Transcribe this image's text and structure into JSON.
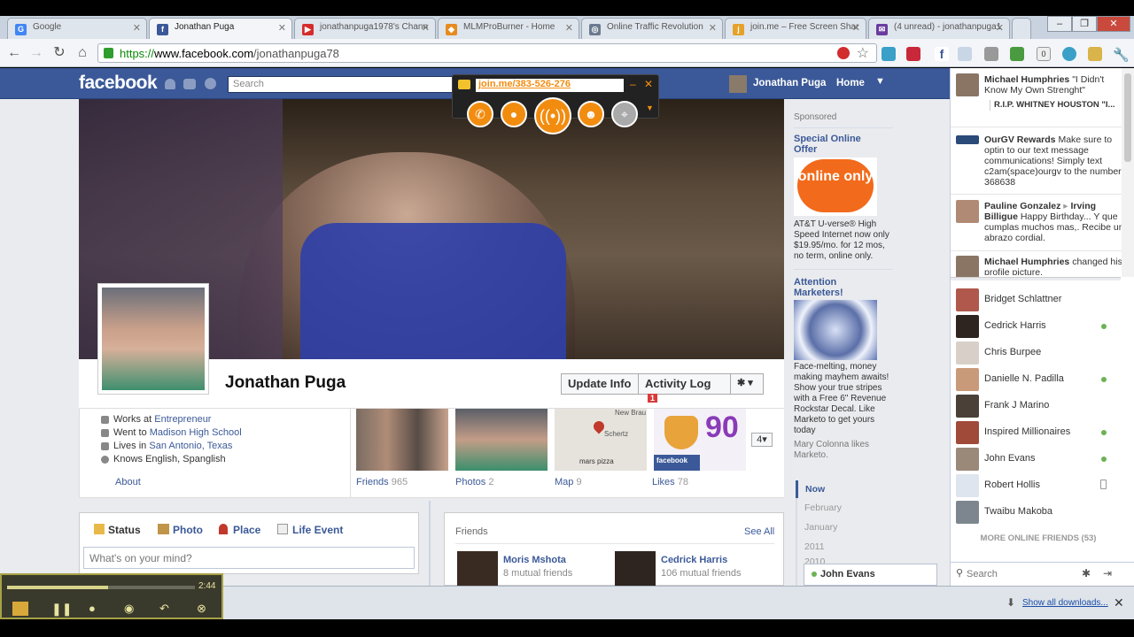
{
  "browser": {
    "tabs": [
      {
        "label": "Google",
        "fav": "G",
        "color": "#4285f4"
      },
      {
        "label": "Jonathan Puga",
        "fav": "f",
        "color": "#3b5998"
      },
      {
        "label": "jonathanpuga1978's Chann",
        "fav": "▶",
        "color": "#d62b2b"
      },
      {
        "label": "MLMProBurner - Home",
        "fav": "◆",
        "color": "#e78b1f"
      },
      {
        "label": "Online Traffic Revolution",
        "fav": "◎",
        "color": "#6b7a8f"
      },
      {
        "label": "join.me – Free Screen Shar",
        "fav": "j",
        "color": "#e5a12a"
      },
      {
        "label": "(4 unread) - jonathanpuga1",
        "fav": "✉",
        "color": "#6a3ca0"
      }
    ],
    "url_scheme": "https://",
    "url_host": "www.facebook.com",
    "url_path": "/jonathanpuga78",
    "ext_badge": "0"
  },
  "facebook": {
    "logo": "facebook",
    "search_placeholder": "Search",
    "nav_user": "Jonathan Puga",
    "nav_home": "Home",
    "profile_name": "Jonathan Puga",
    "update_info": "Update Info",
    "activity_log": "Activity Log",
    "activity_badge": "1",
    "about": {
      "works_prefix": "Works at ",
      "works": "Entrepreneur",
      "went_prefix": "Went to ",
      "went": "Madison High School",
      "lives_prefix": "Lives in ",
      "lives": "San Antonio, Texas",
      "knows": "Knows English, Spanglish",
      "label": "About"
    },
    "apps": {
      "friends": "Friends",
      "friends_count": "965",
      "photos": "Photos",
      "photos_count": "2",
      "map": "Map",
      "map_count": "9",
      "likes": "Likes",
      "likes_count": "78",
      "more": "4",
      "map_town1": "New Brau",
      "map_town2": "Schertz",
      "map_place": "mars pizza",
      "likes_tile_text": "facebook",
      "likes_number": "90"
    },
    "composer": {
      "status": "Status",
      "photo": "Photo",
      "place": "Place",
      "life_event": "Life Event",
      "placeholder": "What's on your mind?"
    },
    "friends_box": {
      "title": "Friends",
      "see_all": "See All",
      "f1_name": "Moris Mshota",
      "f1_mutual": "8 mutual friends",
      "f2_name": "Cedrick Harris",
      "f2_mutual": "106 mutual friends"
    },
    "sponsored": {
      "label": "Sponsored",
      "ad1_title": "Special Online Offer",
      "ad1_image_text": "online only",
      "ad1_text": "AT&T U-verse® High Speed Internet now only $19.95/mo. for 12 mos, no term, online only.",
      "ad2_title": "Attention Marketers!",
      "ad2_text": "Face-melting, money making mayhem awaits! Show your true stripes with a Free 6\" Revenue Rockstar Decal. Like Marketo to get yours today",
      "ad2_social": "Mary Colonna likes Marketo."
    },
    "timeline": [
      "Now",
      "February",
      "January",
      "2011",
      "2010"
    ],
    "chat_popup": "John Evans"
  },
  "chat": {
    "ticker": [
      {
        "name": "Michael Humphries",
        "text": " \"I Didn't Know My Own Strenght\"",
        "sub": "R.I.P. WHITNEY HOUSTON \"I..."
      },
      {
        "name": "OurGV Rewards",
        "text": " Make sure to optin to our text message communications! Simply text c2am(space)ourgv to the number 368638",
        "sub": ""
      },
      {
        "name": "Pauline Gonzalez",
        "arrow": " ▸ ",
        "name2": "Irving Billigue",
        "text": " Happy Birthday... Y que cumplas muchos mas,. Recibe un abrazo cordial.",
        "sub": ""
      },
      {
        "name": "Michael Humphries",
        "text": " changed his profile picture.",
        "sub": ""
      }
    ],
    "friends": [
      {
        "name": "Bridget Schlattner",
        "status": "none"
      },
      {
        "name": "Cedrick Harris",
        "status": "online"
      },
      {
        "name": "Chris Burpee",
        "status": "none"
      },
      {
        "name": "Danielle N. Padilla",
        "status": "online"
      },
      {
        "name": "Frank J Marino",
        "status": "none"
      },
      {
        "name": "Inspired Millionaires",
        "status": "online"
      },
      {
        "name": "John Evans",
        "status": "online"
      },
      {
        "name": "Robert Hollis",
        "status": "mobile"
      },
      {
        "name": "Twaibu Makoba",
        "status": "none"
      }
    ],
    "more_online": "MORE ONLINE FRIENDS (53)",
    "search_placeholder": "Search"
  },
  "joinme": {
    "link": "join.me/383-526-276"
  },
  "downloads": {
    "show_all": "Show all downloads..."
  },
  "recorder": {
    "time": "2:44",
    "progress": 0.54
  }
}
